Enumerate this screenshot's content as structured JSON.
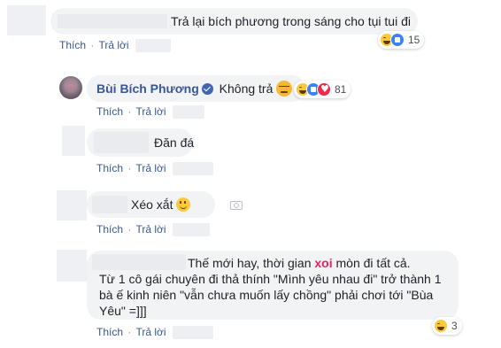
{
  "comments": [
    {
      "text": "Trả lại bích phương trong sáng cho tụi tui đi",
      "actions": {
        "like": "Thích",
        "sep": "·",
        "reply": "Trả lời"
      },
      "reactions": {
        "types": [
          "haha-icon",
          "like-icon"
        ],
        "count": "15"
      }
    },
    {
      "author": "Bùi Bích Phương",
      "verified": true,
      "text": "Không trả",
      "trailing_emoji": "angry-face-icon",
      "actions": {
        "like": "Thích",
        "sep": "·",
        "reply": "Trả lời"
      },
      "reactions": {
        "types": [
          "haha-icon",
          "like-icon",
          "love-icon"
        ],
        "count": "81"
      }
    },
    {
      "text": "Đăn đá",
      "actions": {
        "like": "Thích",
        "sep": "·",
        "reply": "Trả lời"
      }
    },
    {
      "text": "Xéo xắt",
      "trailing_emoji": "smile-icon",
      "actions": {
        "like": "Thích",
        "sep": "·",
        "reply": "Trả lời"
      }
    },
    {
      "line1_a": "Thế mới hay, thời gian ",
      "line1_highlight": "xoi",
      "line1_b": " mòn đi tất cả.",
      "line2": "Từ 1 cô gái chuyên đi thả thính \"Mình yêu nhau đi\" trở thành 1",
      "line3": "bà ế kinh niên \"vẫn chưa muốn lấy chồng\" phải chơi tới \"Bùa",
      "line4": "Yêu\" =]]]",
      "actions": {
        "like": "Thích",
        "sep": "·",
        "reply": "Trả lời"
      },
      "reactions": {
        "types": [
          "haha-icon"
        ],
        "count": "3"
      }
    }
  ],
  "colors": {
    "link": "#385898",
    "bubble": "#f2f3f5",
    "highlight": "#e0245e"
  }
}
